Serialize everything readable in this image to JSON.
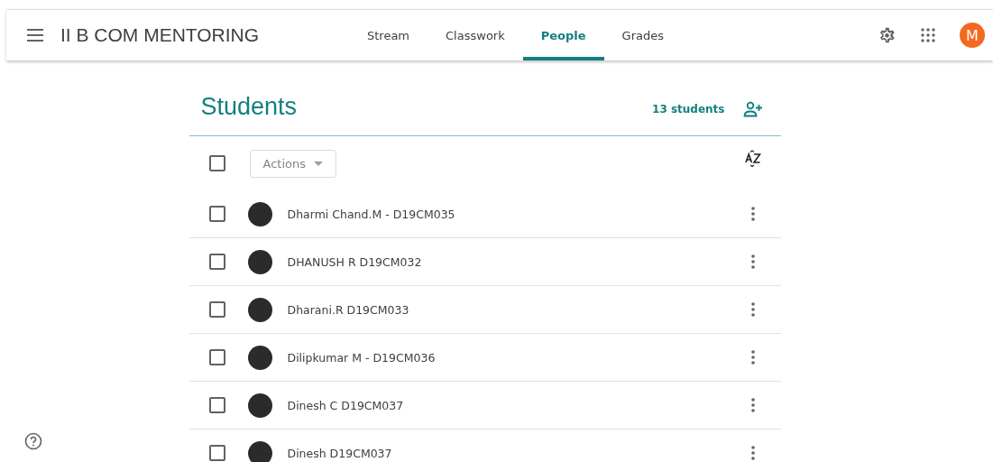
{
  "header": {
    "class_name": "II B COM MENTORING",
    "tabs": [
      {
        "label": "Stream",
        "selected": false
      },
      {
        "label": "Classwork",
        "selected": false
      },
      {
        "label": "People",
        "selected": true
      },
      {
        "label": "Grades",
        "selected": false
      }
    ],
    "avatar_letter": "M"
  },
  "students": {
    "title": "Students",
    "count": "13 students",
    "actions": "Actions",
    "select_all": {
      "checked": false
    },
    "rows": [
      {
        "name": "Dharmi Chand.M - D19CM035",
        "checked": false
      },
      {
        "name": "DHANUSH R D19CM032",
        "checked": false
      },
      {
        "name": "Dharani.R D19CM033",
        "checked": false
      },
      {
        "name": "Dilipkumar M - D19CM036",
        "checked": false
      },
      {
        "name": "Dinesh C D19CM037",
        "checked": false
      },
      {
        "name": "Dinesh D19CM037",
        "checked": false
      }
    ]
  }
}
